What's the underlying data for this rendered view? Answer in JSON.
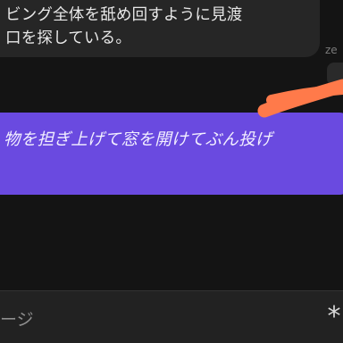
{
  "conversation": {
    "incoming_message": {
      "lines": [
        "ビング全体を舐め回すように見渡",
        "口を探している。"
      ]
    },
    "sender_tag": "ze",
    "outgoing_message": {
      "text": "物を担ぎ上げて窓を開けてぶん投げ"
    }
  },
  "composer": {
    "placeholder": "ージ",
    "action_icon": "asterisk-icon",
    "action_glyph": "*"
  },
  "colors": {
    "background": "#151515",
    "incoming_bubble": "#262626",
    "outgoing_bubble": "#6a4ae0",
    "annotation_stroke": "#ff7a4a",
    "composer_background": "#222222"
  }
}
